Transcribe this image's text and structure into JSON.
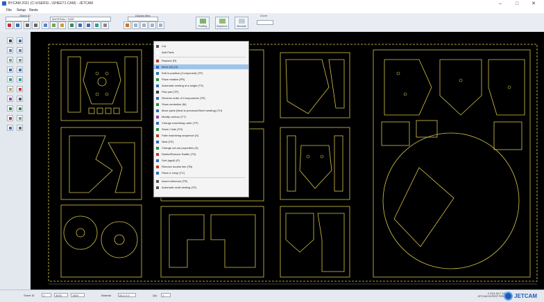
{
  "window": {
    "title": "BYCAM 2021 (C:\\USERS\\...\\SHEET1.CAM) - JETCAM",
    "controls": [
      "–",
      "□",
      "✕"
    ]
  },
  "menu": [
    "File",
    "Setup",
    "Nests"
  ],
  "ribbon": {
    "group_left": "Sheet ID",
    "combo_left": "",
    "combo_mid": "MATERIAL / SIZE",
    "group_mid": "Display filter",
    "combo_right": "",
    "big_buttons": [
      {
        "label": "Profiling",
        "icon": "profiling-icon"
      },
      {
        "label": "Sequence",
        "icon": "sequence-icon"
      },
      {
        "label": "Simulate",
        "icon": "simulate-icon"
      }
    ],
    "zoom_label": "Zoom",
    "zoom_value": ""
  },
  "context_menu": {
    "highlighted_index": 3,
    "items": [
      {
        "label": "Cut",
        "icon": "cut-icon",
        "color": "#555555"
      },
      {
        "label": "Add Parts",
        "icon": "add-icon",
        "color": "#ffffff"
      },
      {
        "label": "Replace (R)",
        "icon": "replace-icon",
        "color": "#c0392b"
      },
      {
        "label": "Move (M) (S)",
        "icon": "move-icon",
        "color": "#2b6cb8"
      },
      {
        "label": "Edit in position (Component) (TP)",
        "icon": "edit-icon",
        "color": "#2b6cb8"
      },
      {
        "label": "Place relative (PR)",
        "icon": "place-icon",
        "color": "#2b8a3e"
      },
      {
        "label": "Automatic nesting of a single (TS)",
        "icon": "autonest-icon",
        "color": "#2b6cb8"
      },
      {
        "label": "Pick part (TP)",
        "icon": "pick-icon",
        "color": "#3a3a3a"
      },
      {
        "label": "Reverse order of Components (TR)",
        "icon": "reverse-icon",
        "color": "#2b6cb8"
      },
      {
        "label": "Show centreline (M)",
        "icon": "centreline-icon",
        "color": "#2b8a3e"
      },
      {
        "label": "Move parts (Nest to previous/Sheet nesting) (TH)",
        "icon": "moveparts-icon",
        "color": "#2b6cb8"
      },
      {
        "label": "Modify contour (TT)",
        "icon": "modify-icon",
        "color": "#8e44ad"
      },
      {
        "label": "Change machining order (TP)",
        "icon": "order-icon",
        "color": "#2b6cb8"
      },
      {
        "label": "Show / hide (TH)",
        "icon": "showhide-icon",
        "color": "#2b8a3e"
      },
      {
        "label": "Fake machining sequence (S)",
        "icon": "sequence-icon",
        "color": "#c0392b"
      },
      {
        "label": "Nest (TE)",
        "icon": "nest-icon",
        "color": "#2b6cb8"
      },
      {
        "label": "Change cut-out properties (S)",
        "icon": "cutout-icon",
        "color": "#2b8a3e"
      },
      {
        "label": "Delete/Remove Swiftie (TS)",
        "icon": "delete-icon",
        "color": "#c0392b"
      },
      {
        "label": "Sort (appli) (P)",
        "icon": "sort-icon",
        "color": "#2b6cb8"
      },
      {
        "label": "Remove double line (TB)",
        "icon": "double-line-icon",
        "color": "#c0392b"
      },
      {
        "label": "Place a Jump (TC)",
        "icon": "jump-icon",
        "color": "#2b6cb8"
      },
      {
        "label": "Insert reference (TR)",
        "icon": "insert-icon",
        "color": "#555555"
      },
      {
        "label": "Automatic multi nesting (TE)",
        "icon": "multinest-icon",
        "color": "#555555"
      }
    ]
  },
  "statusbar": {
    "sheet_label": "Sheet ID",
    "sheet_val": "1",
    "w_val": "3000",
    "h_val": "1500",
    "material_label": "Material",
    "material_val": "ALU 2.0",
    "thick_label": "Qty",
    "thick_val": "1",
    "coords_line1": "X 2311.06 Y 1468.35",
    "coords_line2": "JETCAM EXPERT PREMIUM",
    "brand": "JETCAM"
  },
  "colors": {
    "canvas": "#000000",
    "geometry": "#d8c64a",
    "sheet_border": "#e8d84f",
    "highlight": "#9fc4ea"
  }
}
